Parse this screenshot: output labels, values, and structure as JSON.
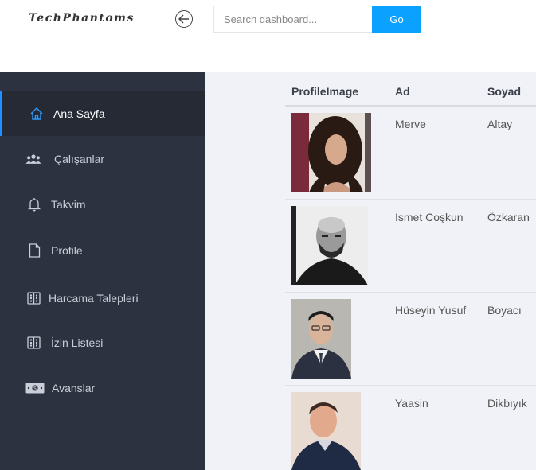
{
  "header": {
    "logo": "TechPhantoms",
    "search_placeholder": "Search dashboard...",
    "go_label": "Go"
  },
  "sidebar": {
    "items": [
      {
        "label": "Ana Sayfa",
        "icon": "home-icon",
        "active": true
      },
      {
        "label": "Çalışanlar",
        "icon": "users-icon"
      },
      {
        "label": "Takvim",
        "icon": "bell-icon"
      },
      {
        "label": "Profile",
        "icon": "file-icon"
      },
      {
        "label": "Harcama Talepleri",
        "icon": "list-icon"
      },
      {
        "label": "İzin Listesi",
        "icon": "list-icon"
      },
      {
        "label": "Avanslar",
        "icon": "money-icon"
      }
    ]
  },
  "table": {
    "columns": [
      "ProfileImage",
      "Ad",
      "Soyad"
    ],
    "rows": [
      {
        "ad": "Merve",
        "soyad": "Altay"
      },
      {
        "ad": "İsmet Coşkun",
        "soyad": "Özkaran"
      },
      {
        "ad": "Hüseyin Yusuf",
        "soyad": "Boyacı"
      },
      {
        "ad": "Yaasin",
        "soyad": "Dikbıyık"
      }
    ]
  },
  "colors": {
    "accent": "#0aa1ff",
    "sidebar_bg": "#2c323f",
    "sidebar_active": "#252a35",
    "content_bg": "#f1f2f7"
  }
}
